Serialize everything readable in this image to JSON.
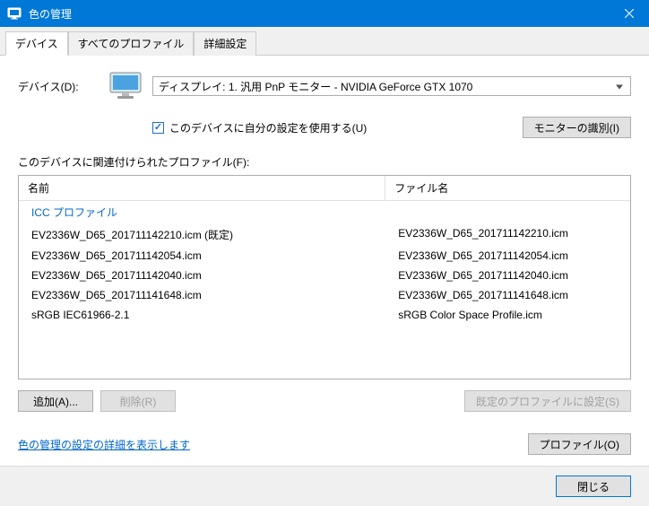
{
  "title": "色の管理",
  "tabs": {
    "device": "デバイス",
    "all_profiles": "すべてのプロファイル",
    "advanced": "詳細設定"
  },
  "device_label": "デバイス(D):",
  "device_selected": "ディスプレイ: 1. 汎用 PnP モニター - NVIDIA GeForce GTX 1070",
  "use_settings_checkbox": "このデバイスに自分の設定を使用する(U)",
  "identify_button": "モニターの識別(I)",
  "profiles_label": "このデバイスに関連付けられたプロファイル(F):",
  "columns": {
    "name": "名前",
    "file": "ファイル名"
  },
  "group_header": "ICC プロファイル",
  "profiles": [
    {
      "name": "EV2336W_D65_201711142210.icm (既定)",
      "file": "EV2336W_D65_201711142210.icm"
    },
    {
      "name": "EV2336W_D65_201711142054.icm",
      "file": "EV2336W_D65_201711142054.icm"
    },
    {
      "name": "EV2336W_D65_201711142040.icm",
      "file": "EV2336W_D65_201711142040.icm"
    },
    {
      "name": "EV2336W_D65_201711141648.icm",
      "file": "EV2336W_D65_201711141648.icm"
    },
    {
      "name": "sRGB IEC61966-2.1",
      "file": "sRGB Color Space Profile.icm"
    }
  ],
  "buttons": {
    "add": "追加(A)...",
    "remove": "削除(R)",
    "set_default": "既定のプロファイルに設定(S)",
    "profiles": "プロファイル(O)",
    "close": "閉じる"
  },
  "advanced_link": "色の管理の設定の詳細を表示します"
}
